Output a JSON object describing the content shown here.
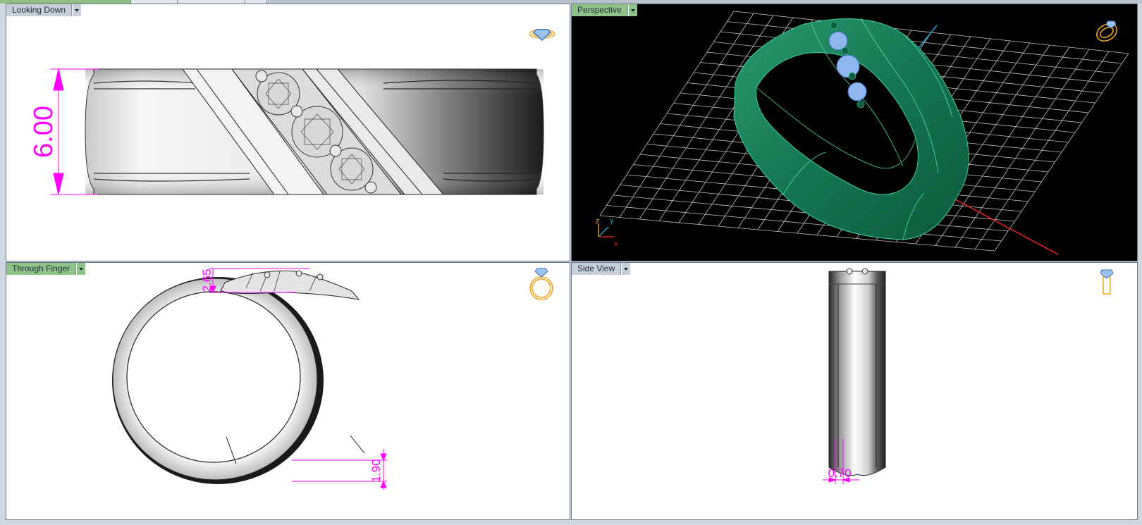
{
  "viewports": {
    "top_left": {
      "label": "Looking Down",
      "dimension": "6.00",
      "active": false
    },
    "top_right": {
      "label": "Perspective",
      "active": true,
      "axes": {
        "z": "z",
        "y": "y",
        "x": "x"
      }
    },
    "bottom_left": {
      "label": "Through Finger",
      "active": true,
      "dimension_top": "2.65",
      "dimension_bottom": "1.90"
    },
    "bottom_right": {
      "label": "Side View",
      "dimension": "0.70",
      "active": false
    }
  },
  "colors": {
    "dimension": "#ff00ff",
    "ring_green": "#1e7a5a",
    "gem_blue": "#8fb6ee",
    "grid": "#bfbfbf",
    "axis_red": "#d42020",
    "axis_cyan": "#1fa3c7",
    "icon_orange": "#f2a51a"
  },
  "icons": {
    "top_left": "ring-top-view-icon",
    "top_right": "ring-perspective-icon",
    "bottom_left": "ring-front-view-icon",
    "bottom_right": "ring-side-view-icon"
  }
}
